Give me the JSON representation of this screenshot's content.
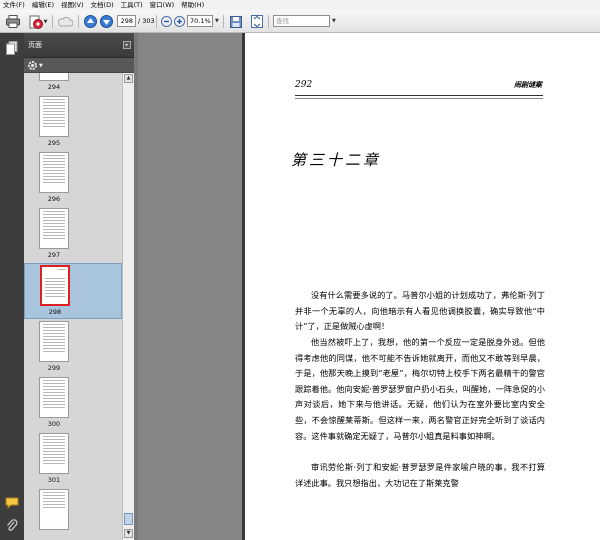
{
  "menubar": {
    "items": [
      "文件(F)",
      "编辑(E)",
      "视图(V)",
      "文档(D)",
      "工具(T)",
      "窗口(W)",
      "帮助(H)"
    ]
  },
  "toolbar": {
    "current_page": "298",
    "total_pages": "/ 303",
    "zoom": "70.1%",
    "search_placeholder": "查找"
  },
  "pages_panel": {
    "title": "页面",
    "thumbnails": [
      {
        "num": "294",
        "selected": false
      },
      {
        "num": "295",
        "selected": false
      },
      {
        "num": "296",
        "selected": false
      },
      {
        "num": "297",
        "selected": false
      },
      {
        "num": "298",
        "selected": true
      },
      {
        "num": "299",
        "selected": false
      },
      {
        "num": "300",
        "selected": false
      },
      {
        "num": "301",
        "selected": false
      }
    ]
  },
  "document": {
    "header_page_number": "292",
    "header_title": "闹剧谜案",
    "chapter_title": "第三十二章",
    "paragraphs": [
      "没有什么需要多说的了。马普尔小姐的计划成功了，弗伦斯·列丁并非一个无辜的人，向他暗示有人看见他调换胶囊，确实导致他“中计”了，正是做贼心虚啊！",
      "他当然被吓上了，我想，他的第一个反应一定是脱身外逃。但他得考虑他的同谋，他不可能不告诉她就离开，而他又不敢等到早晨，于是，他那天晚上摸到“老屋”，梅尔切特上校手下两名最精干的警官跟踪着他。他向安妮·普罗瑟罗窗户扔小石头，叫醒她，一阵急促的小声对谈后，她下来与他讲话。无疑，他们认为在室外要比室内安全些，不会惊醒莱蒂斯。但这样一来，两名警官正好完全听到了谈话内容。这件事就确定无疑了，马普尔小姐真是料事如神啊。",
      "审讯劳伦斯·列丁和安妮·普罗瑟罗是件家喻户晓的事，我不打算详述此事。我只想指出，大功记在了斯莱克警"
    ]
  },
  "colors": {
    "selected_thumb_bg": "#a9c4dd",
    "selected_page_border": "#e02020",
    "panel_bg": "#6b6b6b"
  }
}
